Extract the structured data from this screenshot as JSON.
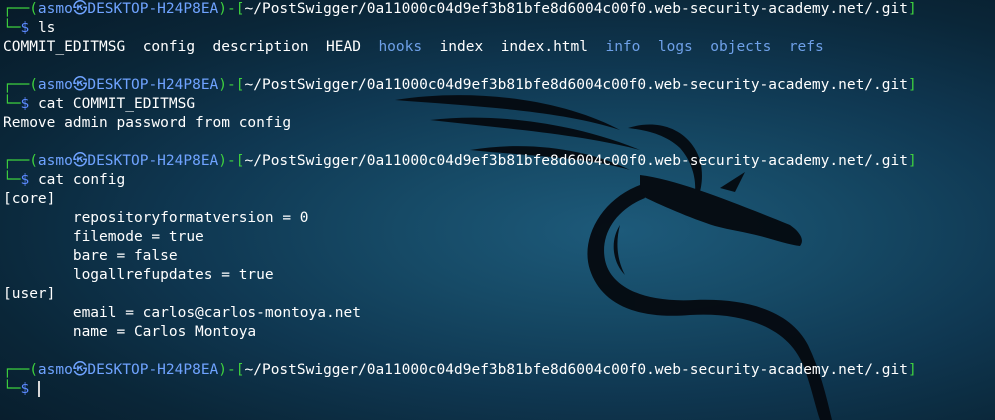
{
  "prompt": {
    "user": "asmo",
    "host": "DESKTOP-H24P8EA",
    "path": "~/PostSwigger/0a11000c04d9ef3b81bfe8d6004c00f0.web-security-academy.net/.git",
    "symbol": "$",
    "user_icon": "kali-skull-icon"
  },
  "commands": [
    {
      "command": "ls",
      "output": {
        "entries": [
          {
            "name": "COMMIT_EDITMSG",
            "type": "file"
          },
          {
            "name": "config",
            "type": "file"
          },
          {
            "name": "description",
            "type": "file"
          },
          {
            "name": "HEAD",
            "type": "file"
          },
          {
            "name": "hooks",
            "type": "dir"
          },
          {
            "name": "index",
            "type": "file"
          },
          {
            "name": "index.html",
            "type": "file"
          },
          {
            "name": "info",
            "type": "dir"
          },
          {
            "name": "logs",
            "type": "dir"
          },
          {
            "name": "objects",
            "type": "dir"
          },
          {
            "name": "refs",
            "type": "dir"
          }
        ]
      }
    },
    {
      "command": "cat COMMIT_EDITMSG",
      "output": {
        "lines": [
          "Remove admin password from config"
        ]
      }
    },
    {
      "command": "cat config",
      "output": {
        "lines": [
          "[core]",
          "        repositoryformatversion = 0",
          "        filemode = true",
          "        bare = false",
          "        logallrefupdates = true",
          "[user]",
          "        email = carlos@carlos-montoya.net",
          "        name = Carlos Montoya"
        ]
      }
    }
  ],
  "colors": {
    "prompt_frame": "#3ed13e",
    "prompt_host": "#6fa3ff",
    "directory_entry": "#6ea0e8",
    "text": "#ffffff",
    "background": "#0f3751"
  }
}
